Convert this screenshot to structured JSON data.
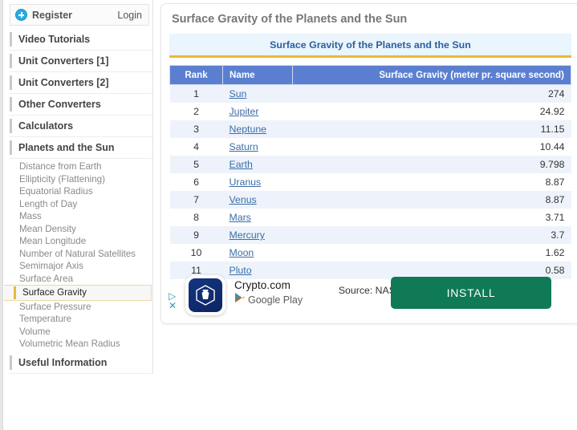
{
  "account": {
    "register_label": "Register",
    "login_label": "Login"
  },
  "sidebar": {
    "sections": [
      {
        "label": "Video Tutorials"
      },
      {
        "label": "Unit Converters [1]"
      },
      {
        "label": "Unit Converters [2]"
      },
      {
        "label": "Other Converters"
      },
      {
        "label": "Calculators"
      },
      {
        "label": "Planets and the Sun"
      }
    ],
    "planet_items": [
      {
        "label": "Distance from Earth",
        "active": false
      },
      {
        "label": "Ellipticity (Flattening)",
        "active": false
      },
      {
        "label": "Equatorial Radius",
        "active": false
      },
      {
        "label": "Length of Day",
        "active": false
      },
      {
        "label": "Mass",
        "active": false
      },
      {
        "label": "Mean Density",
        "active": false
      },
      {
        "label": "Mean Longitude",
        "active": false
      },
      {
        "label": "Number of Natural Satellites",
        "active": false
      },
      {
        "label": "Semimajor Axis",
        "active": false
      },
      {
        "label": "Surface Area",
        "active": false
      },
      {
        "label": "Surface Gravity",
        "active": true
      },
      {
        "label": "Surface Pressure",
        "active": false
      },
      {
        "label": "Temperature",
        "active": false
      },
      {
        "label": "Volume",
        "active": false
      },
      {
        "label": "Volumetric Mean Radius",
        "active": false
      }
    ],
    "footer_section": {
      "label": "Useful Information"
    }
  },
  "main": {
    "page_title": "Surface Gravity of the Planets and the Sun",
    "table_banner": "Surface Gravity of the Planets and the Sun",
    "source": "Source: NASA"
  },
  "chart_data": {
    "type": "table",
    "title": "Surface Gravity of the Planets and the Sun",
    "columns": [
      "Rank",
      "Name",
      "Surface Gravity (meter pr. square second)"
    ],
    "xlabel": "Name",
    "ylabel": "Surface Gravity (meter pr. square second)",
    "categories": [
      "Sun",
      "Jupiter",
      "Neptune",
      "Saturn",
      "Earth",
      "Uranus",
      "Venus",
      "Mars",
      "Mercury",
      "Moon",
      "Pluto"
    ],
    "values": [
      274,
      24.92,
      11.15,
      10.44,
      9.798,
      8.87,
      8.87,
      3.71,
      3.7,
      1.62,
      0.58
    ],
    "rows": [
      {
        "rank": "1",
        "name": "Sun",
        "value": "274"
      },
      {
        "rank": "2",
        "name": "Jupiter",
        "value": "24.92"
      },
      {
        "rank": "3",
        "name": "Neptune",
        "value": "11.15"
      },
      {
        "rank": "4",
        "name": "Saturn",
        "value": "10.44"
      },
      {
        "rank": "5",
        "name": "Earth",
        "value": "9.798"
      },
      {
        "rank": "6",
        "name": "Uranus",
        "value": "8.87"
      },
      {
        "rank": "7",
        "name": "Venus",
        "value": "8.87"
      },
      {
        "rank": "8",
        "name": "Mars",
        "value": "3.71"
      },
      {
        "rank": "9",
        "name": "Mercury",
        "value": "3.7"
      },
      {
        "rank": "10",
        "name": "Moon",
        "value": "1.62"
      },
      {
        "rank": "11",
        "name": "Pluto",
        "value": "0.58"
      }
    ],
    "source": "Source: NASA"
  },
  "ad": {
    "title": "Crypto.com",
    "store": "Google Play",
    "install_label": "INSTALL"
  },
  "colors": {
    "table_header_blue": "#5b7fd0",
    "banner_bg": "#eaf5fd",
    "banner_text": "#2d5f9e",
    "banner_underline": "#edb73a",
    "row_alt": "#eef3fb",
    "link": "#3a6ea5",
    "active_marker": "#e8b93a",
    "install_green": "#0f7a55"
  }
}
